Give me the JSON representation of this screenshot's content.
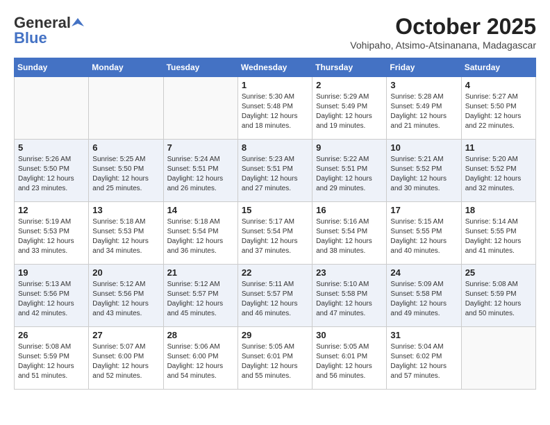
{
  "logo": {
    "general": "General",
    "blue": "Blue"
  },
  "header": {
    "month": "October 2025",
    "location": "Vohipaho, Atsimo-Atsinanana, Madagascar"
  },
  "weekdays": [
    "Sunday",
    "Monday",
    "Tuesday",
    "Wednesday",
    "Thursday",
    "Friday",
    "Saturday"
  ],
  "weeks": [
    [
      {
        "day": "",
        "info": ""
      },
      {
        "day": "",
        "info": ""
      },
      {
        "day": "",
        "info": ""
      },
      {
        "day": "1",
        "info": "Sunrise: 5:30 AM\nSunset: 5:48 PM\nDaylight: 12 hours\nand 18 minutes."
      },
      {
        "day": "2",
        "info": "Sunrise: 5:29 AM\nSunset: 5:49 PM\nDaylight: 12 hours\nand 19 minutes."
      },
      {
        "day": "3",
        "info": "Sunrise: 5:28 AM\nSunset: 5:49 PM\nDaylight: 12 hours\nand 21 minutes."
      },
      {
        "day": "4",
        "info": "Sunrise: 5:27 AM\nSunset: 5:50 PM\nDaylight: 12 hours\nand 22 minutes."
      }
    ],
    [
      {
        "day": "5",
        "info": "Sunrise: 5:26 AM\nSunset: 5:50 PM\nDaylight: 12 hours\nand 23 minutes."
      },
      {
        "day": "6",
        "info": "Sunrise: 5:25 AM\nSunset: 5:50 PM\nDaylight: 12 hours\nand 25 minutes."
      },
      {
        "day": "7",
        "info": "Sunrise: 5:24 AM\nSunset: 5:51 PM\nDaylight: 12 hours\nand 26 minutes."
      },
      {
        "day": "8",
        "info": "Sunrise: 5:23 AM\nSunset: 5:51 PM\nDaylight: 12 hours\nand 27 minutes."
      },
      {
        "day": "9",
        "info": "Sunrise: 5:22 AM\nSunset: 5:51 PM\nDaylight: 12 hours\nand 29 minutes."
      },
      {
        "day": "10",
        "info": "Sunrise: 5:21 AM\nSunset: 5:52 PM\nDaylight: 12 hours\nand 30 minutes."
      },
      {
        "day": "11",
        "info": "Sunrise: 5:20 AM\nSunset: 5:52 PM\nDaylight: 12 hours\nand 32 minutes."
      }
    ],
    [
      {
        "day": "12",
        "info": "Sunrise: 5:19 AM\nSunset: 5:53 PM\nDaylight: 12 hours\nand 33 minutes."
      },
      {
        "day": "13",
        "info": "Sunrise: 5:18 AM\nSunset: 5:53 PM\nDaylight: 12 hours\nand 34 minutes."
      },
      {
        "day": "14",
        "info": "Sunrise: 5:18 AM\nSunset: 5:54 PM\nDaylight: 12 hours\nand 36 minutes."
      },
      {
        "day": "15",
        "info": "Sunrise: 5:17 AM\nSunset: 5:54 PM\nDaylight: 12 hours\nand 37 minutes."
      },
      {
        "day": "16",
        "info": "Sunrise: 5:16 AM\nSunset: 5:54 PM\nDaylight: 12 hours\nand 38 minutes."
      },
      {
        "day": "17",
        "info": "Sunrise: 5:15 AM\nSunset: 5:55 PM\nDaylight: 12 hours\nand 40 minutes."
      },
      {
        "day": "18",
        "info": "Sunrise: 5:14 AM\nSunset: 5:55 PM\nDaylight: 12 hours\nand 41 minutes."
      }
    ],
    [
      {
        "day": "19",
        "info": "Sunrise: 5:13 AM\nSunset: 5:56 PM\nDaylight: 12 hours\nand 42 minutes."
      },
      {
        "day": "20",
        "info": "Sunrise: 5:12 AM\nSunset: 5:56 PM\nDaylight: 12 hours\nand 43 minutes."
      },
      {
        "day": "21",
        "info": "Sunrise: 5:12 AM\nSunset: 5:57 PM\nDaylight: 12 hours\nand 45 minutes."
      },
      {
        "day": "22",
        "info": "Sunrise: 5:11 AM\nSunset: 5:57 PM\nDaylight: 12 hours\nand 46 minutes."
      },
      {
        "day": "23",
        "info": "Sunrise: 5:10 AM\nSunset: 5:58 PM\nDaylight: 12 hours\nand 47 minutes."
      },
      {
        "day": "24",
        "info": "Sunrise: 5:09 AM\nSunset: 5:58 PM\nDaylight: 12 hours\nand 49 minutes."
      },
      {
        "day": "25",
        "info": "Sunrise: 5:08 AM\nSunset: 5:59 PM\nDaylight: 12 hours\nand 50 minutes."
      }
    ],
    [
      {
        "day": "26",
        "info": "Sunrise: 5:08 AM\nSunset: 5:59 PM\nDaylight: 12 hours\nand 51 minutes."
      },
      {
        "day": "27",
        "info": "Sunrise: 5:07 AM\nSunset: 6:00 PM\nDaylight: 12 hours\nand 52 minutes."
      },
      {
        "day": "28",
        "info": "Sunrise: 5:06 AM\nSunset: 6:00 PM\nDaylight: 12 hours\nand 54 minutes."
      },
      {
        "day": "29",
        "info": "Sunrise: 5:05 AM\nSunset: 6:01 PM\nDaylight: 12 hours\nand 55 minutes."
      },
      {
        "day": "30",
        "info": "Sunrise: 5:05 AM\nSunset: 6:01 PM\nDaylight: 12 hours\nand 56 minutes."
      },
      {
        "day": "31",
        "info": "Sunrise: 5:04 AM\nSunset: 6:02 PM\nDaylight: 12 hours\nand 57 minutes."
      },
      {
        "day": "",
        "info": ""
      }
    ]
  ]
}
